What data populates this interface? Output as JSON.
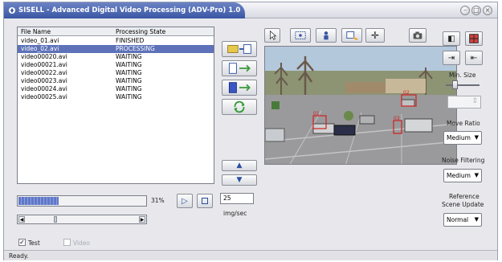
{
  "window": {
    "title": "SISELL - Advanced Digital Video Processing (ADV-Pro) 1.0",
    "controls": [
      "–",
      "□",
      "×"
    ]
  },
  "file_list": {
    "columns": [
      "File Name",
      "Processing State"
    ],
    "rows": [
      {
        "name": "video_01.avi",
        "state": "FINISHED",
        "selected": false
      },
      {
        "name": "video_02.avi",
        "state": "PROCESSING",
        "selected": true
      },
      {
        "name": "video00020.avi",
        "state": "WAITING",
        "selected": false
      },
      {
        "name": "video00021.avi",
        "state": "WAITING",
        "selected": false
      },
      {
        "name": "video00022.avi",
        "state": "WAITING",
        "selected": false
      },
      {
        "name": "video00023.avi",
        "state": "WAITING",
        "selected": false
      },
      {
        "name": "video00024.avi",
        "state": "WAITING",
        "selected": false
      },
      {
        "name": "video00025.avi",
        "state": "WAITING",
        "selected": false
      }
    ]
  },
  "progress": {
    "value": 0.31,
    "label": "31%"
  },
  "fps": {
    "value": "25",
    "unit": "img/sec"
  },
  "options": {
    "test_label": "Test",
    "test_checked": true,
    "video_label": "Video",
    "video_checked": false
  },
  "video": {
    "boxes": [
      "01",
      "02",
      "03"
    ]
  },
  "right_panel": {
    "min_size_label": "Min. Size",
    "move_ratio_label": "Move Ratio",
    "move_ratio_value": "Medium",
    "noise_label": "Noise Filtering",
    "noise_value": "Medium",
    "ref_label_1": "Reference",
    "ref_label_2": "Scene Update",
    "ref_value": "Normal"
  },
  "status": {
    "text": "Ready."
  },
  "icons": {
    "toolbar": [
      "pointer-icon",
      "select-region-icon",
      "person-region-icon",
      "zoom-region-icon",
      "move-icon",
      "camera-icon"
    ],
    "side": [
      "prev-icon",
      "grid-icon",
      "step-forward-icon",
      "step-back-icon"
    ]
  }
}
